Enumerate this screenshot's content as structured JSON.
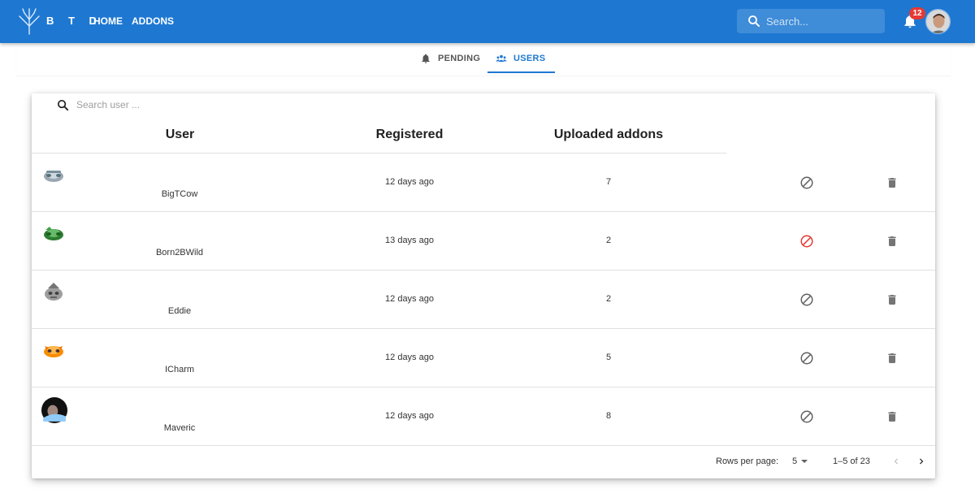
{
  "header": {
    "brand": "B T D",
    "nav": {
      "home": "HOME",
      "addons": "ADDONS"
    },
    "search_placeholder": "Search...",
    "notification_count": "12",
    "accent_color": "#1e78d2"
  },
  "tabs": {
    "pending": "PENDING",
    "users": "USERS",
    "active": "USERS"
  },
  "users_table": {
    "search_placeholder": "Search user ...",
    "columns": {
      "user": "User",
      "registered": "Registered",
      "uploaded": "Uploaded addons"
    },
    "rows": [
      {
        "name": "BigTCow",
        "registered": "12 days ago",
        "uploaded": "7",
        "banned": false,
        "avatar_icon": "monkey-avatar-icon"
      },
      {
        "name": "Born2BWild",
        "registered": "13 days ago",
        "uploaded": "2",
        "banned": true,
        "avatar_icon": "monkey-avatar-icon"
      },
      {
        "name": "Eddie",
        "registered": "12 days ago",
        "uploaded": "2",
        "banned": false,
        "avatar_icon": "monkey-avatar-icon"
      },
      {
        "name": "ICharm",
        "registered": "12 days ago",
        "uploaded": "5",
        "banned": false,
        "avatar_icon": "monkey-avatar-icon"
      },
      {
        "name": "Maveric",
        "registered": "12 days ago",
        "uploaded": "8",
        "banned": false,
        "avatar_icon": "photo-avatar-icon"
      }
    ],
    "footer": {
      "rows_per_page_label": "Rows per page:",
      "rows_per_page": "5",
      "range": "1–5 of 23"
    }
  }
}
